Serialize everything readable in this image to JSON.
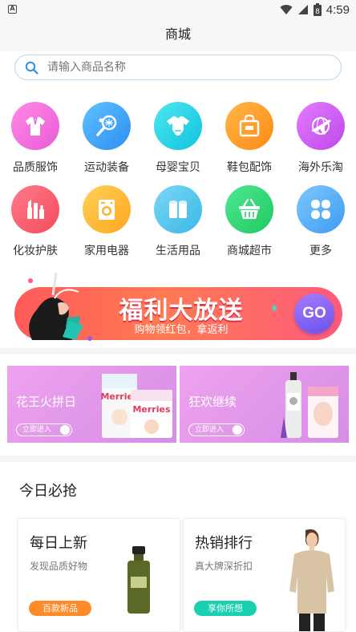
{
  "status_bar": {
    "time": "4:59",
    "battery_badge": "8"
  },
  "header": {
    "title": "商城"
  },
  "search": {
    "placeholder": "请输入商品名称"
  },
  "categories": [
    {
      "label": "品质服饰",
      "icon": "shirt-icon",
      "color": "#f26de1"
    },
    {
      "label": "运动装备",
      "icon": "racket-icon",
      "color": "#3ea7f5"
    },
    {
      "label": "母婴宝贝",
      "icon": "baby-clothes-icon",
      "color": "#1ed6e8"
    },
    {
      "label": "鞋包配饰",
      "icon": "handbag-icon",
      "color": "#ff9a1c"
    },
    {
      "label": "海外乐淘",
      "icon": "globe-plane-icon",
      "color": "#cf5df0"
    },
    {
      "label": "化妆护肤",
      "icon": "cosmetics-icon",
      "color": "#ff5b6f"
    },
    {
      "label": "家用电器",
      "icon": "washing-machine-icon",
      "color": "#ffb52b"
    },
    {
      "label": "生活用品",
      "icon": "tissue-roll-icon",
      "color": "#52c8ef"
    },
    {
      "label": "商城超市",
      "icon": "basket-icon",
      "color": "#2dd677"
    },
    {
      "label": "更多",
      "icon": "grid-more-icon",
      "color": "#57b1f2"
    }
  ],
  "banner": {
    "title": "福利大放送",
    "subtitle": "购物领红包，拿返利",
    "go_label": "GO"
  },
  "promos": [
    {
      "title": "花王火拼日",
      "button": "立即进入"
    },
    {
      "title": "狂欢继续",
      "button": "立即进入"
    }
  ],
  "today": {
    "title": "今日必抢",
    "cards": [
      {
        "title": "每日上新",
        "subtitle": "发现品质好物",
        "button": "百款新品",
        "button_color": "#ff8a2a"
      },
      {
        "title": "热销排行",
        "subtitle": "真大牌深折扣",
        "button": "享你所想",
        "button_color": "#19d1b0"
      }
    ]
  }
}
